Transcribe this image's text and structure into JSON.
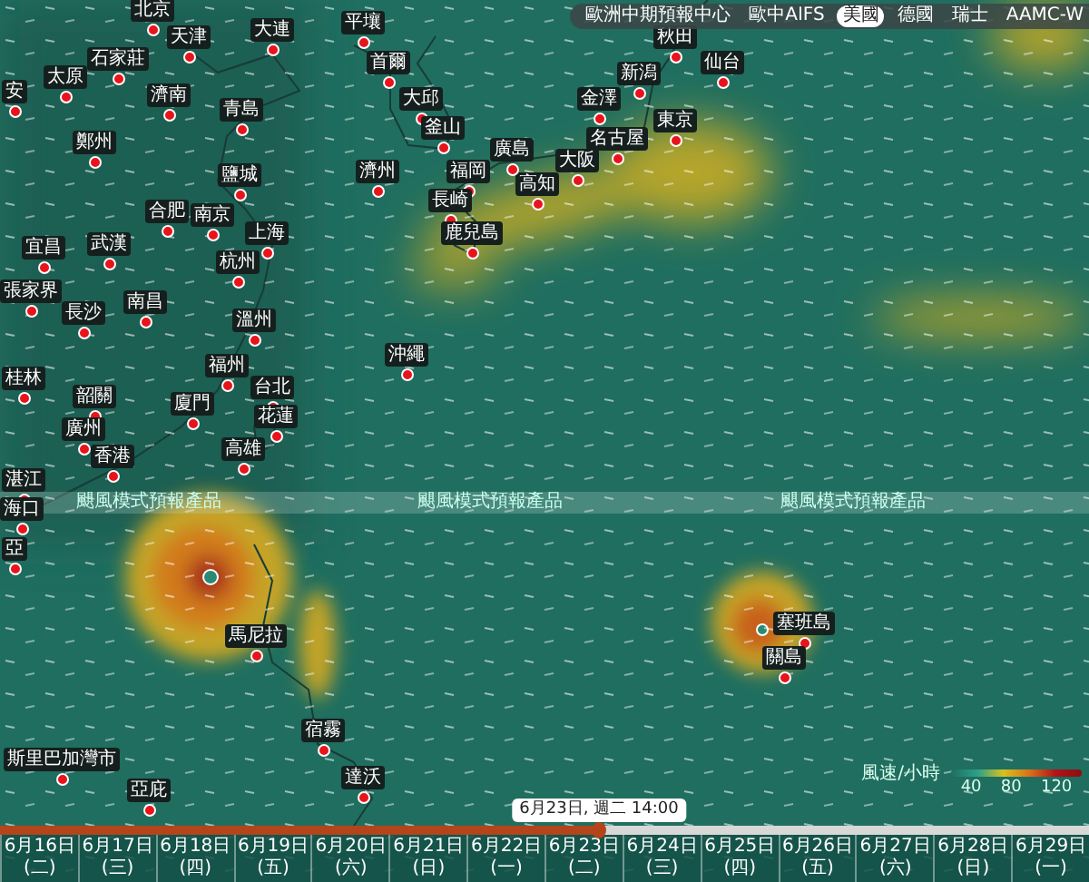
{
  "map": {
    "cities": [
      {
        "name": "安"
      },
      {
        "name": "北京"
      },
      {
        "name": "天津"
      },
      {
        "name": "石家莊"
      },
      {
        "name": "太原"
      },
      {
        "name": "濟南"
      },
      {
        "name": "青島"
      },
      {
        "name": "大連"
      },
      {
        "name": "平壤"
      },
      {
        "name": "首爾"
      },
      {
        "name": "秋田"
      },
      {
        "name": "新潟"
      },
      {
        "name": "仙台"
      },
      {
        "name": "金澤"
      },
      {
        "name": "東京"
      },
      {
        "name": "名古屋"
      },
      {
        "name": "大阪"
      },
      {
        "name": "高知"
      },
      {
        "name": "廣島"
      },
      {
        "name": "大邱"
      },
      {
        "name": "釜山"
      },
      {
        "name": "濟州"
      },
      {
        "name": "福岡"
      },
      {
        "name": "長崎"
      },
      {
        "name": "鹿兒島"
      },
      {
        "name": "沖繩"
      },
      {
        "name": "鄭州"
      },
      {
        "name": "鹽城"
      },
      {
        "name": "合肥"
      },
      {
        "name": "南京"
      },
      {
        "name": "上海"
      },
      {
        "name": "宜昌"
      },
      {
        "name": "武漢"
      },
      {
        "name": "杭州"
      },
      {
        "name": "張家界"
      },
      {
        "name": "南昌"
      },
      {
        "name": "長沙"
      },
      {
        "name": "溫州"
      },
      {
        "name": "福州"
      },
      {
        "name": "台北"
      },
      {
        "name": "桂林"
      },
      {
        "name": "韶關"
      },
      {
        "name": "廈門"
      },
      {
        "name": "花蓮"
      },
      {
        "name": "廣州"
      },
      {
        "name": "香港"
      },
      {
        "name": "高雄"
      },
      {
        "name": "湛江"
      },
      {
        "name": "海口"
      },
      {
        "name": "亞"
      },
      {
        "name": "馬尼拉"
      },
      {
        "name": "宿霧"
      },
      {
        "name": "達沃"
      },
      {
        "name": "亞庇"
      },
      {
        "name": "斯里巴加灣市"
      },
      {
        "name": "塞班島"
      },
      {
        "name": "關島"
      }
    ]
  },
  "model_tabs": [
    {
      "label": "歐洲中期預報中心",
      "selected": false
    },
    {
      "label": "歐中AIFS",
      "selected": false
    },
    {
      "label": "美國",
      "selected": true
    },
    {
      "label": "德國",
      "selected": false
    },
    {
      "label": "瑞士",
      "selected": false
    },
    {
      "label": "AAMC-W",
      "selected": false
    }
  ],
  "hurricane_band": [
    "颶風模式預報產品",
    "颶風模式預報產品",
    "颶風模式預報產品"
  ],
  "legend": {
    "title": "風速/小時",
    "ticks": [
      "40",
      "80",
      "120"
    ]
  },
  "timeline": {
    "tooltip": "6月23日, 週二 14:00",
    "level": 0.55,
    "days": [
      {
        "label": "6月16日 (二)"
      },
      {
        "label": "6月17日 (三)"
      },
      {
        "label": "6月18日 (四)"
      },
      {
        "label": "6月19日 (五)"
      },
      {
        "label": "6月20日 (六)"
      },
      {
        "label": "6月21日 (日)"
      },
      {
        "label": "6月22日 (一)"
      },
      {
        "label": "6月23日 (二)"
      },
      {
        "label": "6月24日 (三)"
      },
      {
        "label": "6月25日 (四)"
      },
      {
        "label": "6月26日 (五)"
      },
      {
        "label": "6月27日 (六)"
      },
      {
        "label": "6月28日 (日)"
      },
      {
        "label": "6月29日 (一)"
      }
    ]
  }
}
